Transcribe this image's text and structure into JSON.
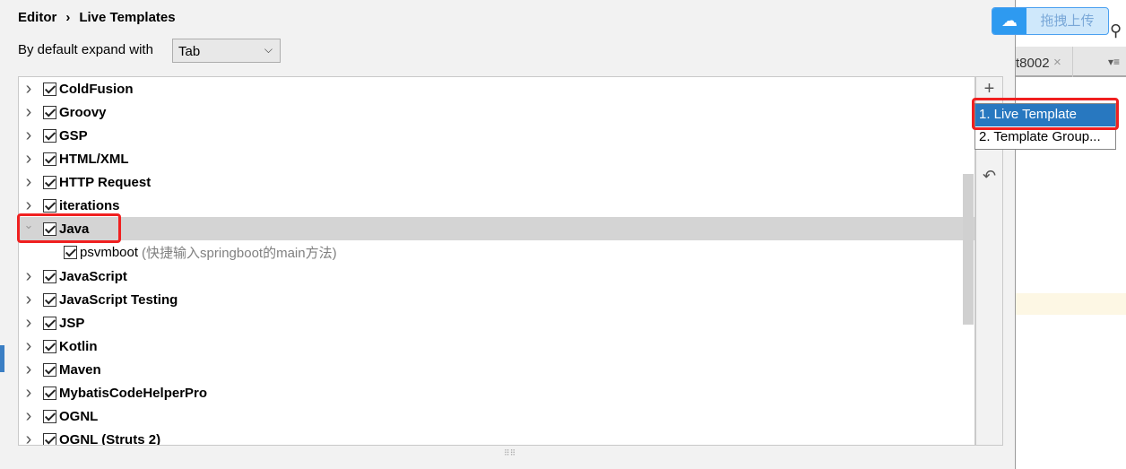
{
  "breadcrumb": [
    "Editor",
    "Live Templates"
  ],
  "expand": {
    "label": "By default expand with",
    "value": "Tab"
  },
  "groups": [
    {
      "name": "ColdFusion",
      "expanded": false,
      "checked": true
    },
    {
      "name": "Groovy",
      "expanded": false,
      "checked": true
    },
    {
      "name": "GSP",
      "expanded": false,
      "checked": true
    },
    {
      "name": "HTML/XML",
      "expanded": false,
      "checked": true
    },
    {
      "name": "HTTP Request",
      "expanded": false,
      "checked": true
    },
    {
      "name": "iterations",
      "expanded": false,
      "checked": true
    },
    {
      "name": "Java",
      "expanded": true,
      "checked": true,
      "selected": true,
      "children": [
        {
          "abbr": "psvmboot",
          "desc": "(快捷输入springboot的main方法)",
          "checked": true
        }
      ]
    },
    {
      "name": "JavaScript",
      "expanded": false,
      "checked": true
    },
    {
      "name": "JavaScript Testing",
      "expanded": false,
      "checked": true
    },
    {
      "name": "JSP",
      "expanded": false,
      "checked": true
    },
    {
      "name": "Kotlin",
      "expanded": false,
      "checked": true
    },
    {
      "name": "Maven",
      "expanded": false,
      "checked": true
    },
    {
      "name": "MybatisCodeHelperPro",
      "expanded": false,
      "checked": true
    },
    {
      "name": "OGNL",
      "expanded": false,
      "checked": true
    },
    {
      "name": "OGNL (Struts 2)",
      "expanded": false,
      "checked": true
    }
  ],
  "toolbar": {
    "add": "+",
    "revert": "↶"
  },
  "popup": {
    "items": [
      "1. Live Template",
      "2. Template Group..."
    ],
    "active": 0
  },
  "baidu": {
    "label": "拖拽上传"
  },
  "editor_tab": {
    "name": "t8002",
    "close": "×"
  },
  "colors": {
    "accent": "#2878c0",
    "highlight": "#f02020",
    "selected_row": "#d4d4d4"
  }
}
